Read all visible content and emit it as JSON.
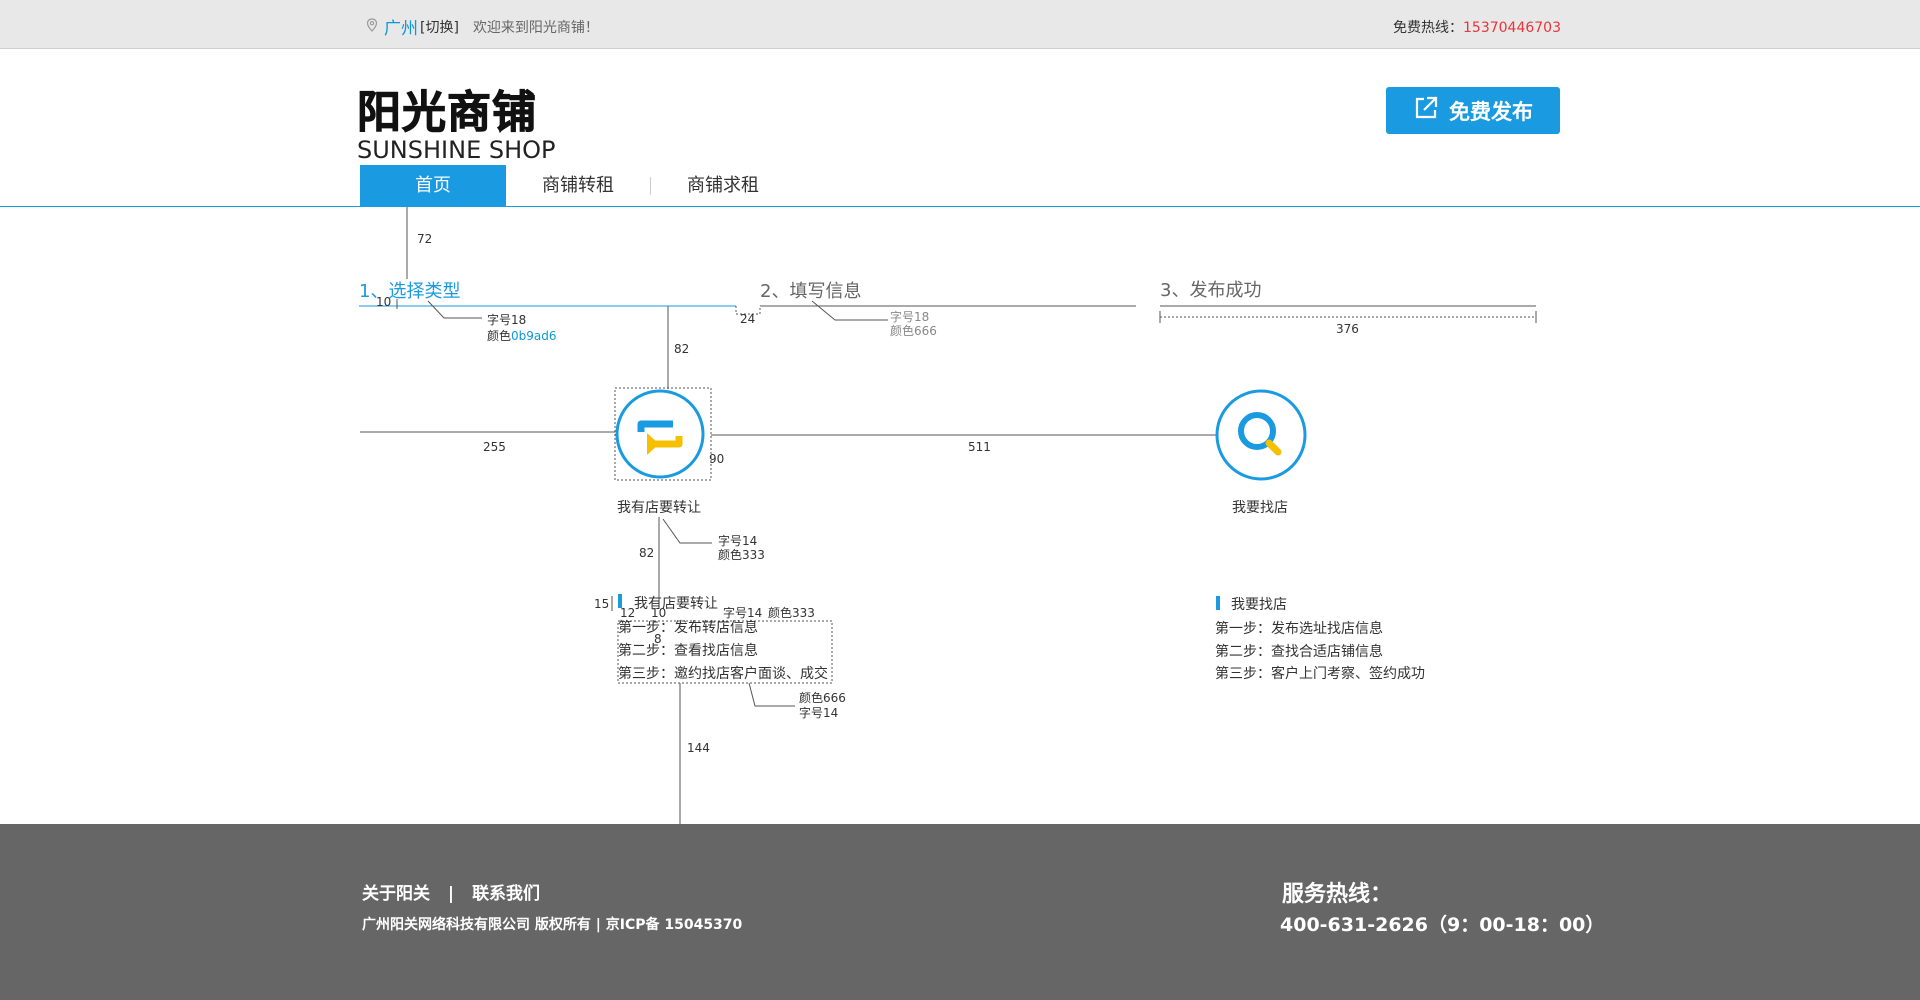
{
  "topbar": {
    "city": "广州",
    "switch": "[切换]",
    "welcome": "欢迎来到阳光商铺！",
    "hotline_label": "免费热线：",
    "hotline_number": "15370446703"
  },
  "logo": {
    "cn": "阳光商铺",
    "en": "SUNSHINE SHOP"
  },
  "header": {
    "publish_label": "免费发布"
  },
  "nav": [
    "首页",
    "商铺转租",
    "商铺求租"
  ],
  "steps": [
    "1、选择类型",
    "2、填写信息",
    "3、发布成功"
  ],
  "options": {
    "transfer_label": "我有店要转让",
    "find_label": "我要找店"
  },
  "cards": {
    "transfer": {
      "title": "我有店要转让",
      "steps": [
        "第一步：发布转店信息",
        "第二步：查看找店信息",
        "第三步：邀约找店客户面谈、成交"
      ]
    },
    "find": {
      "title": "我要找店",
      "steps": [
        "第一步：发布选址找店信息",
        "第二步：查找合适店铺信息",
        "第三步：客户上门考察、签约成功"
      ]
    }
  },
  "annotations": {
    "d72": "72",
    "d10": "10",
    "size18": "字号18",
    "color_prefix": "颜色",
    "color_blue": "0b9ad6",
    "d24": "24",
    "size18b": "字号18",
    "color666": "颜色666",
    "d376": "376",
    "d82a": "82",
    "d255": "255",
    "d90": "90",
    "d511": "511",
    "size14": "字号14",
    "color333": "颜色333",
    "d82b": "82",
    "d15": "15",
    "d12": "12",
    "d10b": "10",
    "size14b": "字号14",
    "color333b": "颜色333",
    "d8": "8",
    "color666b": "颜色666",
    "size14c": "字号14",
    "d144": "144"
  },
  "footer": {
    "about": "关于阳关",
    "sep": "|",
    "contact": "联系我们",
    "copyright": "广州阳关网络科技有限公司 版权所有 | 京ICP备 15045370",
    "hot_title": "服务热线：",
    "hot_number": "400-631-2626（9：00-18：00）"
  },
  "colors": {
    "accent": "#1a9ae0",
    "annotation_blue": "#0b9ad6",
    "hotline": "#e8343a",
    "footer": "#666666",
    "yellow": "#f5c000"
  }
}
